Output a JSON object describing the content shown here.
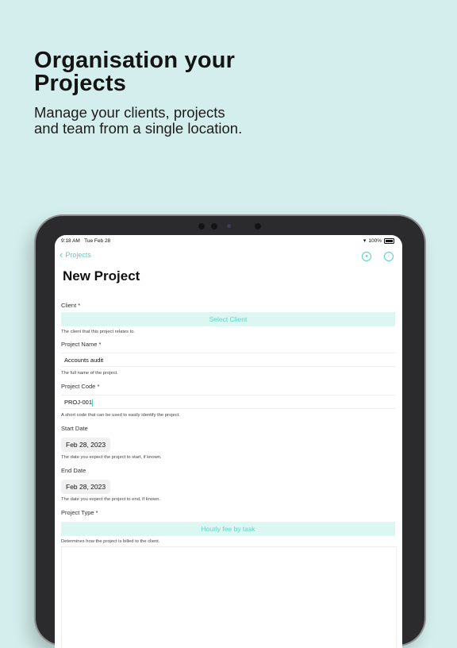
{
  "marketing": {
    "headline_line1": "Organisation your",
    "headline_line2": "Projects",
    "sub_line1": "Manage your clients, projects",
    "sub_line2": "and team from a single location."
  },
  "status_bar": {
    "time": "9:18 AM",
    "date": "Tue Feb 28",
    "battery": "100%"
  },
  "nav": {
    "back_label": "Projects",
    "icons": [
      "person-icon",
      "info-icon"
    ]
  },
  "page": {
    "title": "New Project"
  },
  "form": {
    "client": {
      "label": "Client *",
      "button": "Select Client",
      "helper": "The client that this project relates to."
    },
    "project_name": {
      "label": "Project Name *",
      "value": "Accounts audit",
      "helper": "The full name of the project."
    },
    "project_code": {
      "label": "Project Code *",
      "value": "PROJ-001",
      "helper": "A short code that can be used to easily identify the project."
    },
    "start_date": {
      "label": "Start Date",
      "value": "Feb 28, 2023",
      "helper": "The date you expect the project to start, if known."
    },
    "end_date": {
      "label": "End Date",
      "value": "Feb 28, 2023",
      "helper": "The date you expect the project to end, if known."
    },
    "project_type": {
      "label": "Project Type *",
      "value": "Hourly fee by task",
      "helper": "Determines how the project is billed to the client."
    }
  },
  "colors": {
    "background": "#d3eeec",
    "accent": "#4dd4c2",
    "accent_fill": "#dcf6f2"
  }
}
